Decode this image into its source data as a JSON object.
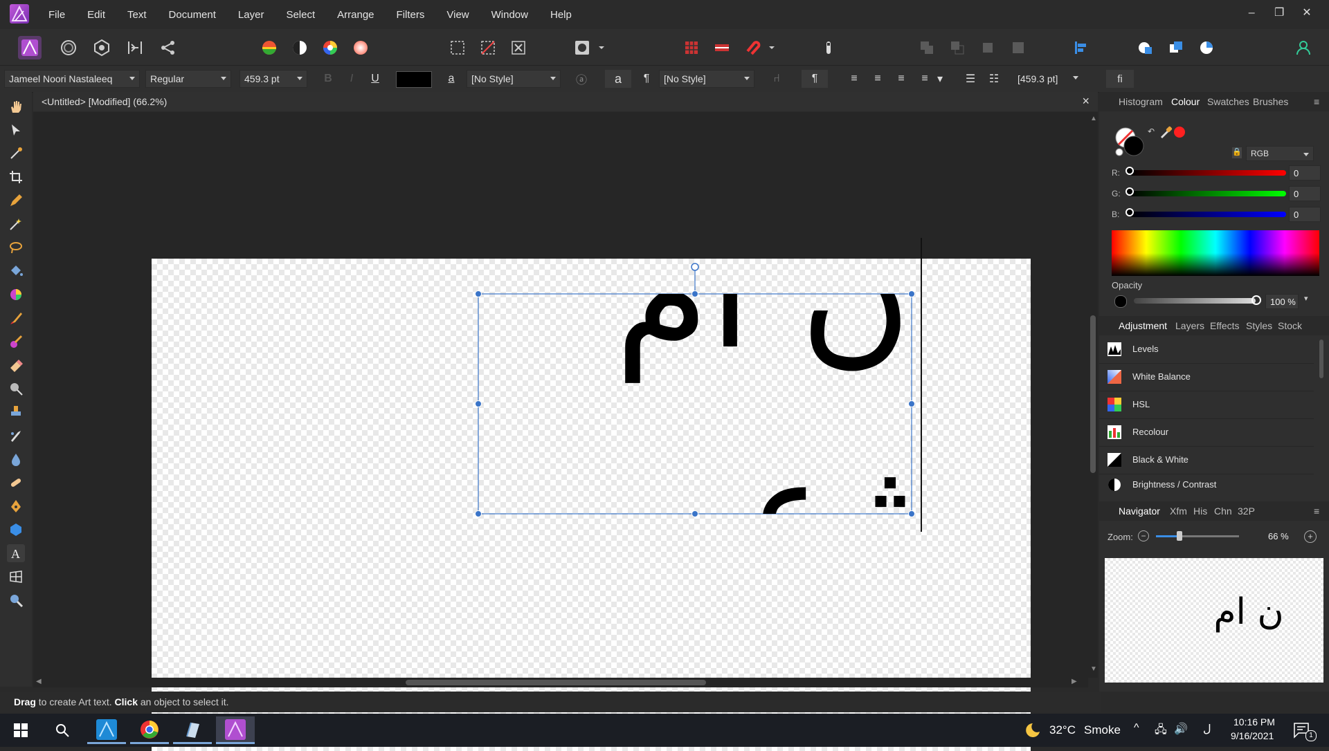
{
  "app": {
    "name": "Affinity Designer"
  },
  "menu": {
    "items": [
      "File",
      "Edit",
      "Text",
      "Document",
      "Layer",
      "Select",
      "Arrange",
      "Filters",
      "View",
      "Window",
      "Help"
    ]
  },
  "context_bar": {
    "font_family": "Jameel Noori Nastaleeq",
    "font_style": "Regular",
    "font_size": "459.3 pt",
    "char_style": "[No Style]",
    "para_style": "[No Style]",
    "leading": "[459.3 pt]",
    "bold": "B",
    "italic": "I",
    "underline": "U",
    "a_glyph": "a",
    "pilcrow": "¶",
    "fi_glyph": "fi"
  },
  "document": {
    "tab_title": "<Untitled> [Modified] (66.2%)",
    "art_text": "ن ام ژع"
  },
  "colour_panel": {
    "tabs": [
      "Histogram",
      "Colour",
      "Swatches",
      "Brushes"
    ],
    "active_tab": "Colour",
    "model": "RGB",
    "r_label": "R:",
    "g_label": "G:",
    "b_label": "B:",
    "r": "0",
    "g": "0",
    "b": "0",
    "opacity_label": "Opacity",
    "opacity": "100 %",
    "fill_color": "#000000",
    "accent_color": "#ff2020"
  },
  "adjustment_panel": {
    "tabs": [
      "Adjustment",
      "Layers",
      "Effects",
      "Styles",
      "Stock"
    ],
    "active_tab": "Adjustment",
    "items": [
      "Levels",
      "White Balance",
      "HSL",
      "Recolour",
      "Black & White",
      "Brightness / Contrast"
    ]
  },
  "navigator_panel": {
    "tabs": [
      "Navigator",
      "Xfm",
      "His",
      "Chn",
      "32P"
    ],
    "active_tab": "Navigator",
    "zoom_label": "Zoom:",
    "zoom_value": "66 %"
  },
  "status": {
    "drag_word": "Drag",
    "drag_text": " to create Art text. ",
    "click_word": "Click",
    "click_text": " an object to select it."
  },
  "taskbar": {
    "weather_temp": "32°C",
    "weather_desc": "Smoke",
    "time": "10:16 PM",
    "date": "9/16/2021",
    "notification_count": "1"
  }
}
